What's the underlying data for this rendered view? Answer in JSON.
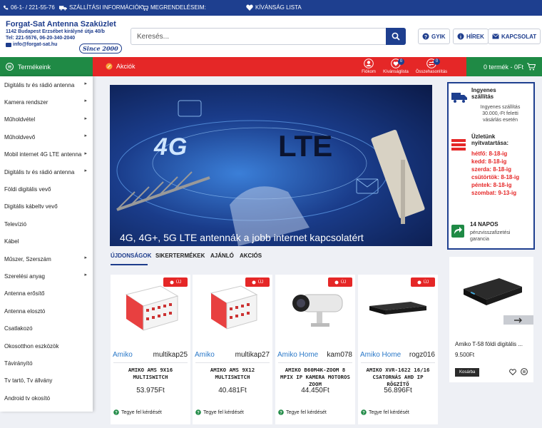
{
  "topbar": {
    "phone": "06-1- / 221-55-76",
    "shipping": "SZÁLLÍTÁSI INFORMÁCIÓK:",
    "orders": "MEGRENDELÉSEIM:",
    "wishlist": "KÍVÁNSÁG LISTA"
  },
  "logo": {
    "name": "Forgat-Sat Antenna Szaküzlet",
    "address": "1142 Budapest Erzsébet királyné útja 40/b",
    "phones": "Tel: 221-5576, 06-20-340-2040",
    "email": "info@forgat-sat.hu",
    "since": "Since 2000"
  },
  "search": {
    "placeholder": "Keresés..."
  },
  "header_buttons": {
    "faq": "GYIK",
    "news": "HÍREK",
    "contact": "KAPCSOLAT"
  },
  "nav": {
    "products": "Termékeink",
    "promo": "Akciók",
    "account": "Fiókom",
    "wishlist": "Kívánságlista",
    "wishlist_count": "0",
    "compare": "Összehasonlítás",
    "compare_count": "0",
    "cart": "0 termék - 0Ft"
  },
  "sidebar": {
    "items": [
      {
        "label": "Digitális tv és rádió antenna",
        "arrow": "▸"
      },
      {
        "label": "Kamera rendszer",
        "arrow": "▸"
      },
      {
        "label": "Műholdvétel",
        "arrow": "▸"
      },
      {
        "label": "Műholdvevő",
        "arrow": "▸"
      },
      {
        "label": "Mobil internet 4G LTE antenna",
        "arrow": "▸"
      },
      {
        "label": "Digitális tv és rádió antenna",
        "arrow": "▸"
      },
      {
        "label": "Földi digitális vevő",
        "arrow": ""
      },
      {
        "label": "Digitális kábeltv vevő",
        "arrow": ""
      },
      {
        "label": "Televízió",
        "arrow": ""
      },
      {
        "label": "Kábel",
        "arrow": ""
      },
      {
        "label": "Műszer, Szerszám",
        "arrow": "▸"
      },
      {
        "label": "Szerelési anyag",
        "arrow": "▸"
      },
      {
        "label": "Antenna erősítő",
        "arrow": ""
      },
      {
        "label": "Antenna elosztó",
        "arrow": ""
      },
      {
        "label": "Csatlakozó",
        "arrow": ""
      },
      {
        "label": "Okosotthon eszközök",
        "arrow": ""
      },
      {
        "label": "Távirányító",
        "arrow": ""
      },
      {
        "label": "Tv tartó, Tv állvány",
        "arrow": ""
      },
      {
        "label": "Android tv okosító",
        "arrow": ""
      }
    ]
  },
  "banner": {
    "tag_4g": "4G",
    "tag_lte": "LTE",
    "caption": "4G, 4G+, 5G LTE antennák a jobb internet kapcsolatért"
  },
  "tabs": [
    "ÚJDONSÁGOK",
    "SIKERTERMÉKEK",
    "AJÁNLÓ",
    "AKCIÓS"
  ],
  "products": [
    {
      "badge": "ÚJ",
      "brand": "Amiko",
      "code": "multikap25",
      "title": "AMIKO AMS 9X16 MULTISWITCH",
      "price": "53.975Ft",
      "ask": "Tegye fel kérdését"
    },
    {
      "badge": "ÚJ",
      "brand": "Amiko",
      "code": "multikap27",
      "title": "AMIKO AMS 9X12 MULTISWITCH",
      "price": "40.481Ft",
      "ask": "Tegye fel kérdését"
    },
    {
      "badge": "ÚJ",
      "brand": "Amiko Home",
      "code": "kam078",
      "title": "AMIKO B60M4K-ZOOM 8 MPIX IP KAMERA MOTOROS ZOOM",
      "price": "44.450Ft",
      "ask": "Tegye fel kérdését"
    },
    {
      "badge": "ÚJ",
      "brand": "Amiko Home",
      "code": "rogz016",
      "title": "AMIKO XVR-1622 16/16 CSATORNÁS AHD IP RÖGZÍTŐ",
      "price": "56.896Ft",
      "ask": "Tegye fel kérdését"
    }
  ],
  "info": {
    "ship_title_1": "Ingyenes",
    "ship_title_2": "szállítás",
    "ship_text_1": "Ingyenes szállítás",
    "ship_text_2": "30.000,-Ft feletti",
    "ship_text_3": "vásárlás esetén",
    "open_title_1": "Üzletünk",
    "open_title_2": "nyitvatartása:",
    "hours": [
      "hétfő: 8-18-ig",
      "kedd: 8-18-ig",
      "szerda: 8-18-ig",
      "csütörtök: 8-18-ig",
      "péntek: 8-18-ig",
      "szombat: 9-13-ig"
    ],
    "refund_title": "14 NAPOS",
    "refund_text_1": "pénzvisszafizetési",
    "refund_text_2": "garancia"
  },
  "side_product": {
    "name": "Amiko T-58 földi digitális ...",
    "price": "9.500Ft",
    "cart_btn": "Kosárba"
  },
  "colors": {
    "primary": "#1e3f8f",
    "green": "#1f8a45",
    "red": "#e52727",
    "brand_link": "#2a78c8"
  }
}
